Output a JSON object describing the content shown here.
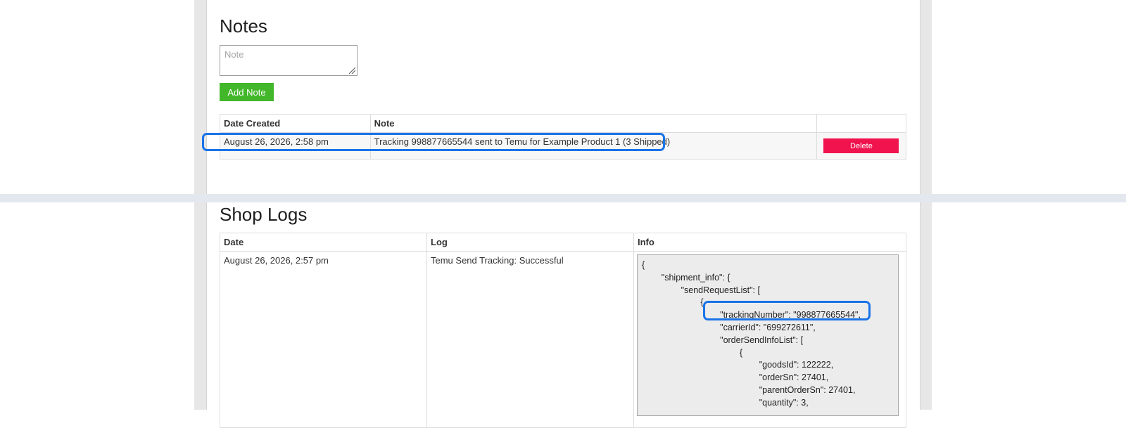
{
  "notes": {
    "title": "Notes",
    "input_placeholder": "Note",
    "add_button_label": "Add Note",
    "table": {
      "headers": [
        "Date Created",
        "Note",
        ""
      ],
      "rows": [
        {
          "date": "August 26, 2026, 2:58 pm",
          "note": "Tracking 998877665544 sent to Temu for Example Product 1 (3 Shipped)",
          "action_label": "Delete"
        }
      ]
    }
  },
  "shop_logs": {
    "title": "Shop Logs",
    "headers": [
      "Date",
      "Log",
      "Info"
    ],
    "rows": [
      {
        "date": "August 26, 2026, 2:57 pm",
        "log": "Temu Send Tracking: Successful",
        "info_lines": [
          "{",
          "        \"shipment_info\": {",
          "                \"sendRequestList\": [",
          "                        {",
          "                                \"trackingNumber\": \"998877665544\",",
          "                                \"carrierId\": \"699272611\",",
          "                                \"orderSendInfoList\": [",
          "                                        {",
          "                                                \"goodsId\": 122222,",
          "                                                \"orderSn\": 27401,",
          "                                                \"parentOrderSn\": 27401,",
          "                                                \"quantity\": 3,"
        ]
      }
    ]
  },
  "colors": {
    "add_button": "#42b72a",
    "delete_button": "#f0134d",
    "highlight": "#1a73e8",
    "separator": "#e3e8ef"
  }
}
